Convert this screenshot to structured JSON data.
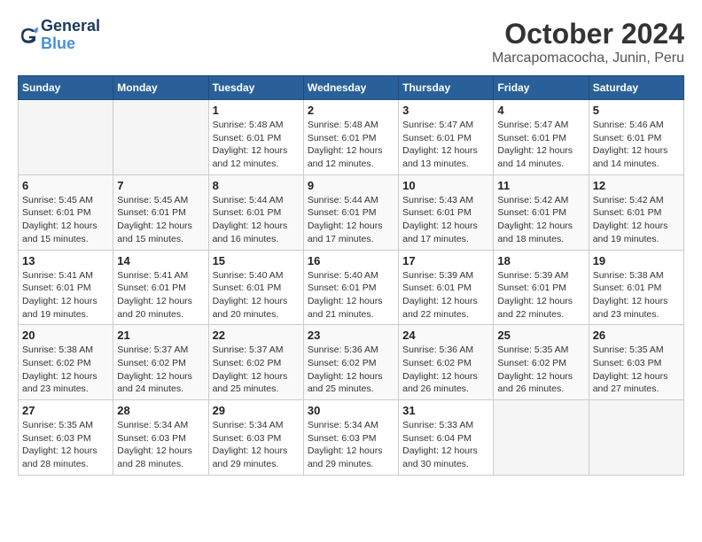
{
  "header": {
    "logo_line1": "General",
    "logo_line2": "Blue",
    "title": "October 2024",
    "subtitle": "Marcapomacocha, Junin, Peru"
  },
  "calendar": {
    "days_of_week": [
      "Sunday",
      "Monday",
      "Tuesday",
      "Wednesday",
      "Thursday",
      "Friday",
      "Saturday"
    ],
    "weeks": [
      [
        {
          "day": "",
          "info": ""
        },
        {
          "day": "",
          "info": ""
        },
        {
          "day": "1",
          "info": "Sunrise: 5:48 AM\nSunset: 6:01 PM\nDaylight: 12 hours and 12 minutes."
        },
        {
          "day": "2",
          "info": "Sunrise: 5:48 AM\nSunset: 6:01 PM\nDaylight: 12 hours and 12 minutes."
        },
        {
          "day": "3",
          "info": "Sunrise: 5:47 AM\nSunset: 6:01 PM\nDaylight: 12 hours and 13 minutes."
        },
        {
          "day": "4",
          "info": "Sunrise: 5:47 AM\nSunset: 6:01 PM\nDaylight: 12 hours and 14 minutes."
        },
        {
          "day": "5",
          "info": "Sunrise: 5:46 AM\nSunset: 6:01 PM\nDaylight: 12 hours and 14 minutes."
        }
      ],
      [
        {
          "day": "6",
          "info": "Sunrise: 5:45 AM\nSunset: 6:01 PM\nDaylight: 12 hours and 15 minutes."
        },
        {
          "day": "7",
          "info": "Sunrise: 5:45 AM\nSunset: 6:01 PM\nDaylight: 12 hours and 15 minutes."
        },
        {
          "day": "8",
          "info": "Sunrise: 5:44 AM\nSunset: 6:01 PM\nDaylight: 12 hours and 16 minutes."
        },
        {
          "day": "9",
          "info": "Sunrise: 5:44 AM\nSunset: 6:01 PM\nDaylight: 12 hours and 17 minutes."
        },
        {
          "day": "10",
          "info": "Sunrise: 5:43 AM\nSunset: 6:01 PM\nDaylight: 12 hours and 17 minutes."
        },
        {
          "day": "11",
          "info": "Sunrise: 5:42 AM\nSunset: 6:01 PM\nDaylight: 12 hours and 18 minutes."
        },
        {
          "day": "12",
          "info": "Sunrise: 5:42 AM\nSunset: 6:01 PM\nDaylight: 12 hours and 19 minutes."
        }
      ],
      [
        {
          "day": "13",
          "info": "Sunrise: 5:41 AM\nSunset: 6:01 PM\nDaylight: 12 hours and 19 minutes."
        },
        {
          "day": "14",
          "info": "Sunrise: 5:41 AM\nSunset: 6:01 PM\nDaylight: 12 hours and 20 minutes."
        },
        {
          "day": "15",
          "info": "Sunrise: 5:40 AM\nSunset: 6:01 PM\nDaylight: 12 hours and 20 minutes."
        },
        {
          "day": "16",
          "info": "Sunrise: 5:40 AM\nSunset: 6:01 PM\nDaylight: 12 hours and 21 minutes."
        },
        {
          "day": "17",
          "info": "Sunrise: 5:39 AM\nSunset: 6:01 PM\nDaylight: 12 hours and 22 minutes."
        },
        {
          "day": "18",
          "info": "Sunrise: 5:39 AM\nSunset: 6:01 PM\nDaylight: 12 hours and 22 minutes."
        },
        {
          "day": "19",
          "info": "Sunrise: 5:38 AM\nSunset: 6:01 PM\nDaylight: 12 hours and 23 minutes."
        }
      ],
      [
        {
          "day": "20",
          "info": "Sunrise: 5:38 AM\nSunset: 6:02 PM\nDaylight: 12 hours and 23 minutes."
        },
        {
          "day": "21",
          "info": "Sunrise: 5:37 AM\nSunset: 6:02 PM\nDaylight: 12 hours and 24 minutes."
        },
        {
          "day": "22",
          "info": "Sunrise: 5:37 AM\nSunset: 6:02 PM\nDaylight: 12 hours and 25 minutes."
        },
        {
          "day": "23",
          "info": "Sunrise: 5:36 AM\nSunset: 6:02 PM\nDaylight: 12 hours and 25 minutes."
        },
        {
          "day": "24",
          "info": "Sunrise: 5:36 AM\nSunset: 6:02 PM\nDaylight: 12 hours and 26 minutes."
        },
        {
          "day": "25",
          "info": "Sunrise: 5:35 AM\nSunset: 6:02 PM\nDaylight: 12 hours and 26 minutes."
        },
        {
          "day": "26",
          "info": "Sunrise: 5:35 AM\nSunset: 6:03 PM\nDaylight: 12 hours and 27 minutes."
        }
      ],
      [
        {
          "day": "27",
          "info": "Sunrise: 5:35 AM\nSunset: 6:03 PM\nDaylight: 12 hours and 28 minutes."
        },
        {
          "day": "28",
          "info": "Sunrise: 5:34 AM\nSunset: 6:03 PM\nDaylight: 12 hours and 28 minutes."
        },
        {
          "day": "29",
          "info": "Sunrise: 5:34 AM\nSunset: 6:03 PM\nDaylight: 12 hours and 29 minutes."
        },
        {
          "day": "30",
          "info": "Sunrise: 5:34 AM\nSunset: 6:03 PM\nDaylight: 12 hours and 29 minutes."
        },
        {
          "day": "31",
          "info": "Sunrise: 5:33 AM\nSunset: 6:04 PM\nDaylight: 12 hours and 30 minutes."
        },
        {
          "day": "",
          "info": ""
        },
        {
          "day": "",
          "info": ""
        }
      ]
    ]
  }
}
